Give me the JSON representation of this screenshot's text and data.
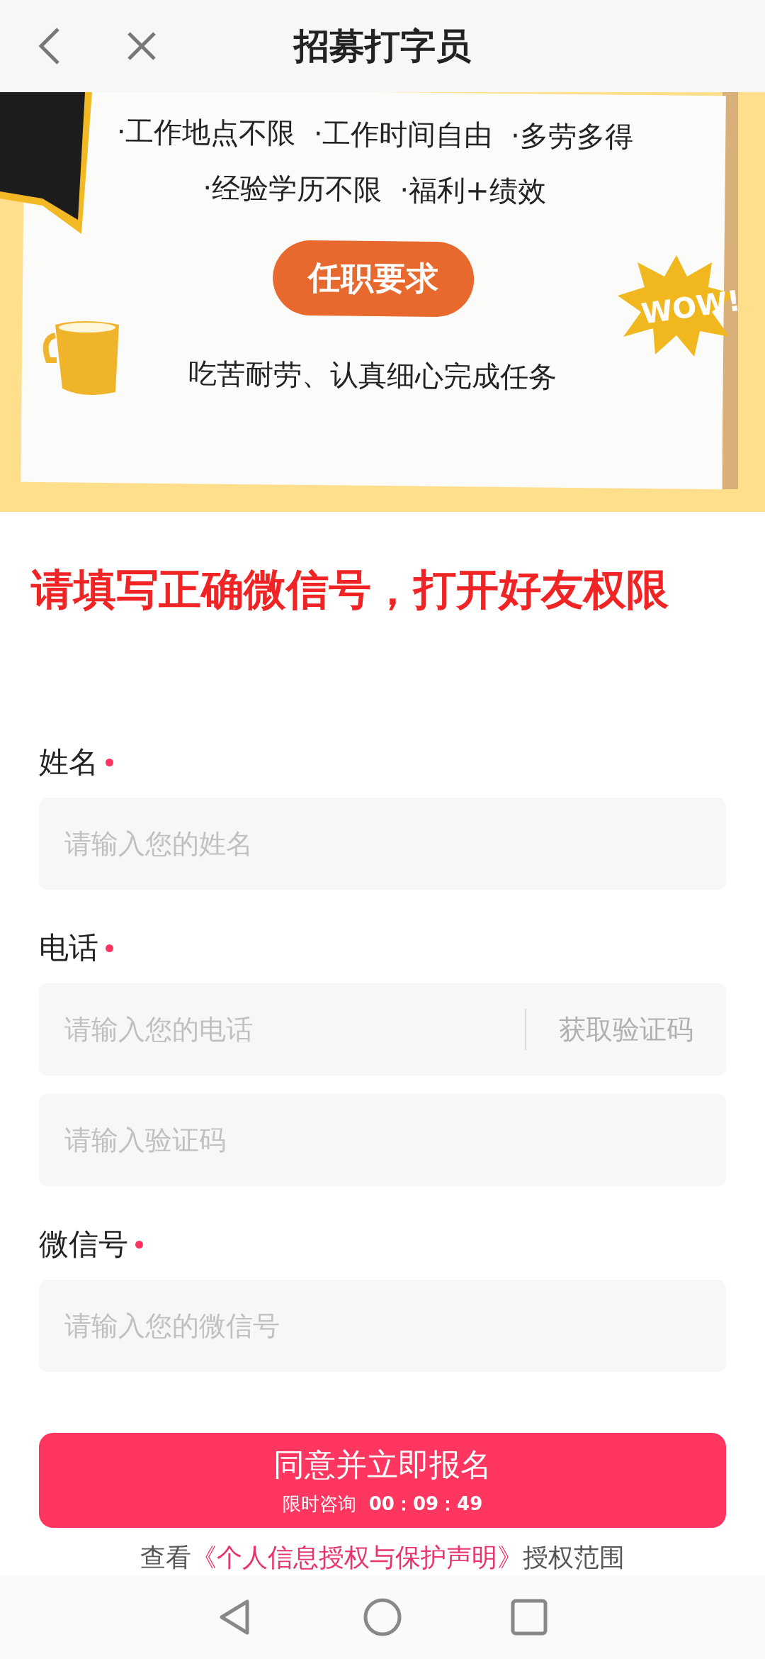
{
  "header": {
    "title": "招募打字员"
  },
  "banner": {
    "benefits_line_1": "·工作地点不限  ·工作时间自由  ·多劳多得",
    "benefits_line_2": "·经验学历不限  ·福利+绩效",
    "requirements_tag": "任职要求",
    "requirements": "吃苦耐劳、认真细心完成任务",
    "sticker": "WOW!"
  },
  "notice": "请填写正确微信号，打开好友权限",
  "form": [
    {
      "kind": "field",
      "label": "姓名",
      "required": true,
      "placeholder": "请输入您的姓名"
    },
    {
      "kind": "field_with_action",
      "label": "电话",
      "required": true,
      "placeholder": "请输入您的电话",
      "action": "获取验证码"
    },
    {
      "kind": "field",
      "placeholder": "请输入验证码"
    },
    {
      "kind": "field",
      "label": "微信号",
      "required": true,
      "placeholder": "请输入您的微信号"
    }
  ],
  "submit": {
    "label": "同意并立即报名",
    "countdown_label": "限时咨询",
    "countdown": "00：09：49"
  },
  "consent": {
    "before": "查看",
    "link": "《个人信息授权与保护声明》",
    "after": "授权范围"
  }
}
